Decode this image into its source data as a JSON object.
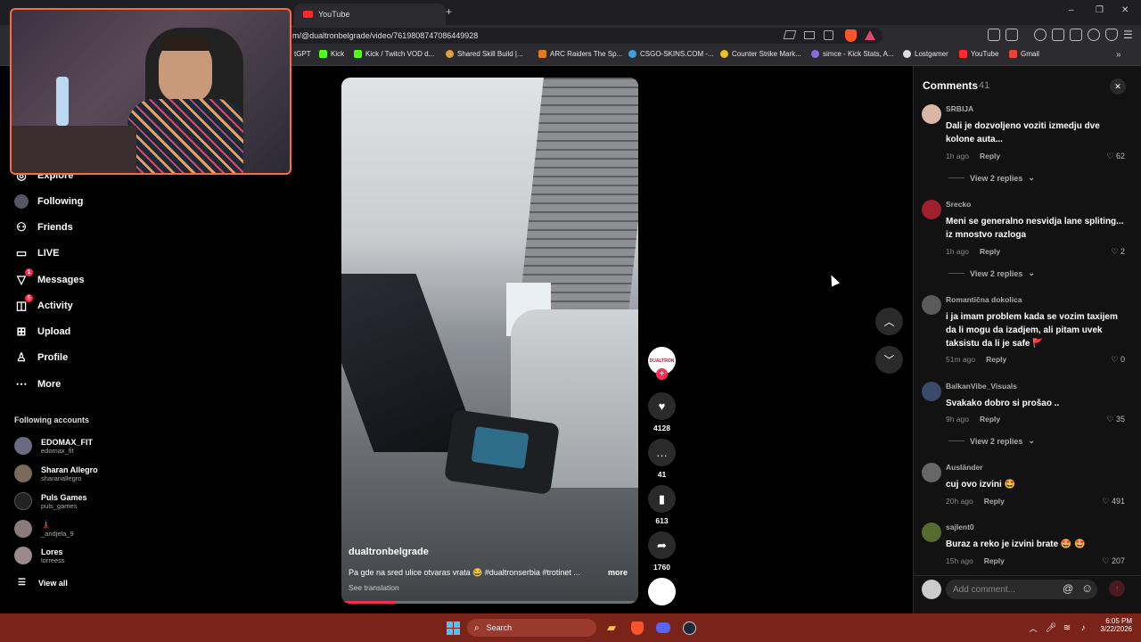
{
  "browser": {
    "tabs": [
      {
        "label": "YouTube"
      }
    ],
    "url": "m/@dualtronbelgrade/video/7619808747086449928",
    "bookmarks": [
      {
        "label": "tGPT"
      },
      {
        "label": "Kick"
      },
      {
        "label": "Kick / Twitch VOD d..."
      },
      {
        "label": "Shared Skill Build |..."
      },
      {
        "label": "ARC Raiders The Sp..."
      },
      {
        "label": "CSGO-SKINS.COM -..."
      },
      {
        "label": "Counter Strike Mark..."
      },
      {
        "label": "simce - Kick Stats, A..."
      },
      {
        "label": "Lostgamer"
      },
      {
        "label": "YouTube"
      },
      {
        "label": "Gmail"
      }
    ],
    "window_controls": {
      "minimize": "–",
      "maximize": "❐",
      "close": "✕"
    },
    "new_tab": "+",
    "overflow": "»"
  },
  "sidebar": {
    "nav": [
      {
        "label": "Explore",
        "icon": "compass-icon"
      },
      {
        "label": "Following",
        "icon": "avatar-icon"
      },
      {
        "label": "Friends",
        "icon": "friends-icon"
      },
      {
        "label": "LIVE",
        "icon": "live-icon"
      },
      {
        "label": "Messages",
        "icon": "messages-icon",
        "badge": "1"
      },
      {
        "label": "Activity",
        "icon": "activity-icon",
        "badge": "5"
      },
      {
        "label": "Upload",
        "icon": "upload-icon"
      },
      {
        "label": "Profile",
        "icon": "profile-icon"
      },
      {
        "label": "More",
        "icon": "more-icon"
      }
    ],
    "following_header": "Following accounts",
    "accounts": [
      {
        "name": "EDOMAX_FIT",
        "handle": "edomax_fit"
      },
      {
        "name": "Sharan Allegro",
        "handle": "sharanallegro"
      },
      {
        "name": "Puls Games",
        "handle": "puls_games"
      },
      {
        "name": "🗼",
        "handle": "_andjela_9"
      },
      {
        "name": "Lores",
        "handle": "lorreess"
      }
    ],
    "view_all": "View all"
  },
  "video": {
    "author": "dualtronbelgrade",
    "caption": "Pa gde na sred ulice otvaras vrata 😂 #dualtronserbia #trotinet ...",
    "more": "more",
    "see_translation": "See translation",
    "progress": 0.18,
    "avatar_label": "DUALTRON",
    "likes": "4128",
    "comments": "41",
    "saves": "613",
    "shares": "1760",
    "follow": "+"
  },
  "comments_panel": {
    "title": "Comments",
    "count": "41",
    "close": "✕",
    "items": [
      {
        "user": "SRBIJA",
        "text": "Dali je dozvoljeno voziti izmedju dve kolone auta...",
        "time": "1h ago",
        "reply": "Reply",
        "likes": "62",
        "replies": "View 2 replies"
      },
      {
        "user": "Srecko",
        "text": "Meni se generalno nesvidja lane spliting... iz mnostvo razloga",
        "time": "1h ago",
        "reply": "Reply",
        "likes": "2",
        "replies": "View 2 replies"
      },
      {
        "user": "Romantična dokolica",
        "text": "i ja imam problem kada se vozim taxijem da li mogu da izadjem, ali pitam uvek taksistu da li je safe 🚩",
        "time": "51m ago",
        "reply": "Reply",
        "likes": "0",
        "replies": ""
      },
      {
        "user": "BalkanVibe_Visuals",
        "text": "Svakako dobro si prošao ..",
        "time": "9h ago",
        "reply": "Reply",
        "likes": "35",
        "replies": "View 2 replies"
      },
      {
        "user": "Ausländer",
        "text": "cuj ovo izvini 🤩",
        "time": "20h ago",
        "reply": "Reply",
        "likes": "491",
        "replies": ""
      },
      {
        "user": "sajlent0",
        "text": "Buraz a reko je izvini brate 🤩 🤩",
        "time": "15h ago",
        "reply": "Reply",
        "likes": "207",
        "replies": ""
      }
    ],
    "input_placeholder": "Add comment...",
    "mention": "@",
    "emoji": "☺",
    "send": "↑"
  },
  "taskbar": {
    "search_label": "Search",
    "time": "6:05 PM",
    "date": "3/22/2026"
  },
  "colors": {
    "accent": "#fe2c55",
    "taskbar": "#7a2318",
    "webcam_border": "#ff6a3d"
  }
}
